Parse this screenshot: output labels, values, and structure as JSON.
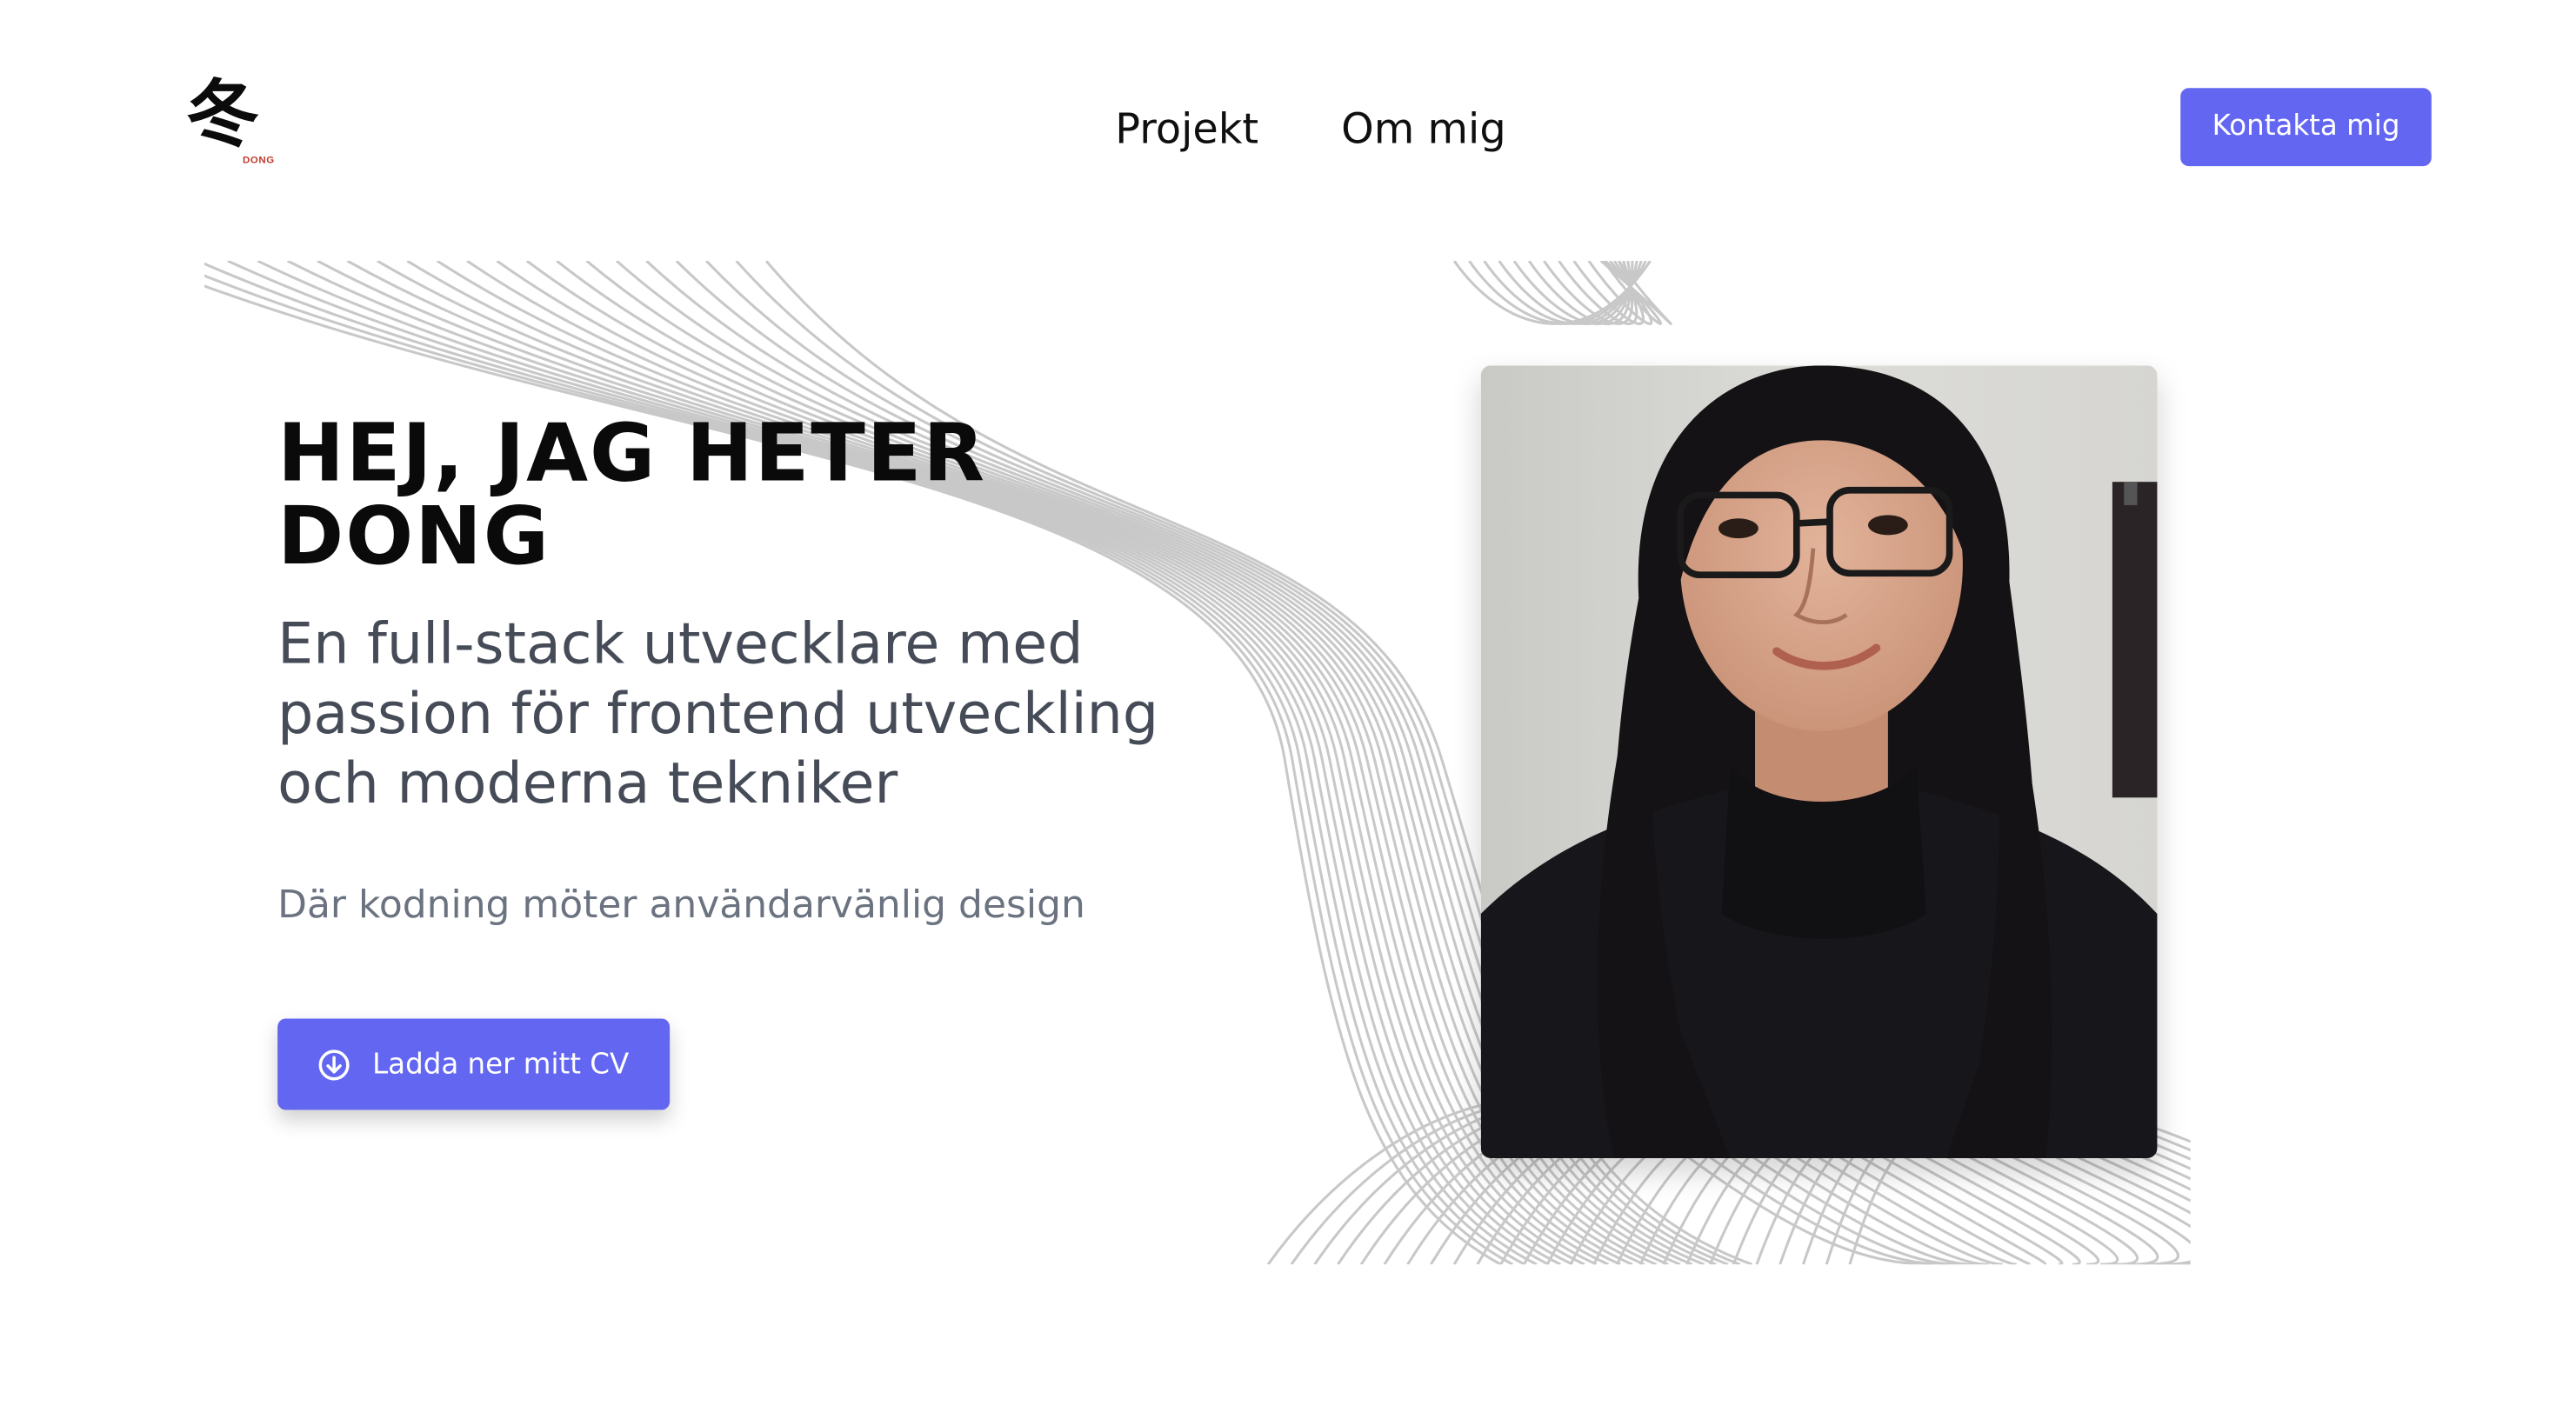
{
  "header": {
    "logo_char": "冬",
    "logo_text": "DONG",
    "nav": [
      {
        "label": "Projekt"
      },
      {
        "label": "Om mig"
      }
    ],
    "contact_button": "Kontakta mig"
  },
  "hero": {
    "title": "HEJ, JAG HETER DONG",
    "subtitle": "En full-stack utvecklare med passion för frontend utveckling och moderna tekniker",
    "tagline": "Där kodning möter användarvänlig design",
    "cv_button": "Ladda ner mitt CV",
    "cv_icon": "download-circle-icon"
  },
  "colors": {
    "accent": "#6366f1",
    "heading": "#0a0a0a",
    "subtitle": "#454b57",
    "tagline": "#6b7280",
    "wave_lines": "#c8c8c8"
  }
}
